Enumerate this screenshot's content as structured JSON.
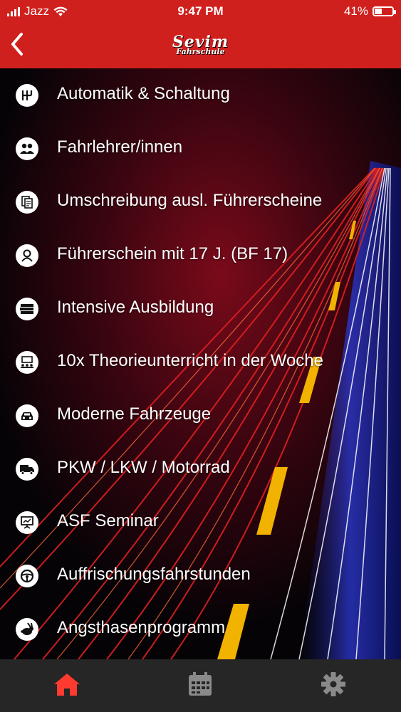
{
  "status_bar": {
    "carrier": "Jazz",
    "time": "9:47 PM",
    "battery": "41%",
    "battery_level": 0.41
  },
  "header": {
    "back_icon": "chevron-left-icon",
    "logo_line1": "Sevim",
    "logo_line2": "Fahrschule"
  },
  "colors": {
    "header": "#d0201d",
    "accent": "#ff3b30",
    "tabbar": "#262626"
  },
  "menu": {
    "items": [
      {
        "label": "Automatik & Schaltung",
        "icon": "gear-shift-icon"
      },
      {
        "label": "Fahrlehrer/innen",
        "icon": "people-icon"
      },
      {
        "label": "Umschreibung ausl. Führerscheine",
        "icon": "documents-icon"
      },
      {
        "label": "Führerschein mit 17 J. (BF 17)",
        "icon": "person-icon"
      },
      {
        "label": "Intensive Ausbildung",
        "icon": "books-icon"
      },
      {
        "label": "10x Theorieunterricht in der Woche",
        "icon": "classroom-icon"
      },
      {
        "label": "Moderne Fahrzeuge",
        "icon": "car-icon"
      },
      {
        "label": "PKW / LKW / Motorrad",
        "icon": "truck-icon"
      },
      {
        "label": "ASF Seminar",
        "icon": "presentation-icon"
      },
      {
        "label": "Auffrischungsfahrstunden",
        "icon": "steering-wheel-icon"
      },
      {
        "label": "Angsthasenprogramm",
        "icon": "rabbit-icon"
      }
    ]
  },
  "tabbar": {
    "tabs": [
      {
        "name": "home",
        "icon": "home-icon",
        "active": true
      },
      {
        "name": "calendar",
        "icon": "calendar-icon",
        "active": false
      },
      {
        "name": "settings",
        "icon": "settings-gear-icon",
        "active": false
      }
    ]
  }
}
